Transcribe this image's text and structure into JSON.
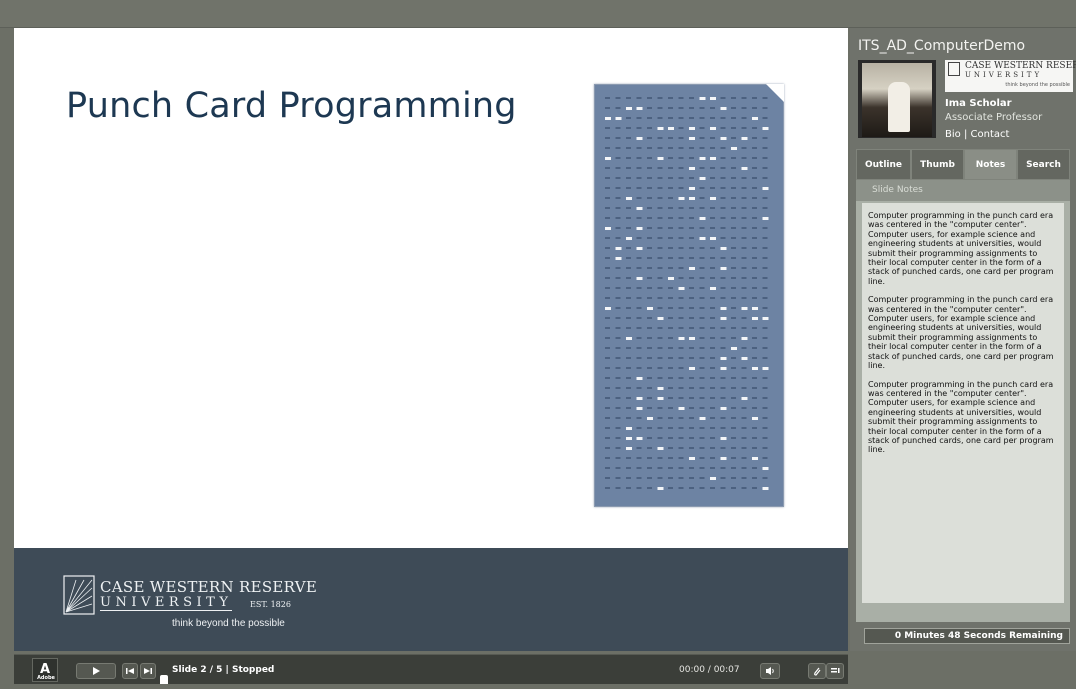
{
  "slide": {
    "title": "Punch Card Programming",
    "logo": {
      "name": "CASE WESTERN RESERVE",
      "university": "UNIVERSITY",
      "est": "EST. 1826",
      "tagline": "think beyond the possible"
    }
  },
  "sidebar": {
    "presentation_title": "ITS_AD_ComputerDemo",
    "small_logo": {
      "name": "CASE WESTERN RESERVE",
      "university": "UNIVERSITY",
      "tagline": "think beyond the possible"
    },
    "presenter": {
      "name": "Ima Scholar",
      "role": "Associate Professor",
      "bio_label": "Bio",
      "separator": "|",
      "contact_label": "Contact"
    },
    "tabs": [
      {
        "label": "Outline"
      },
      {
        "label": "Thumb"
      },
      {
        "label": "Notes"
      },
      {
        "label": "Search"
      }
    ],
    "active_tab": "Notes",
    "notes_header": "Slide Notes",
    "notes": [
      "Computer programming in the punch card era was centered in the \"computer center\". Computer users, for example science and engineering students at universities, would submit their programming assignments to their local computer center in the form of a stack of punched cards, one card per program line.",
      "Computer programming in the punch card era was centered in the \"computer center\". Computer users, for example science and engineering students at universities, would submit their programming assignments to their local computer center in the form of a stack of punched cards, one card per program line.",
      "Computer programming in the punch card era was centered in the \"computer center\". Computer users, for example science and engineering students at universities, would submit their programming assignments to their local computer center in the form of a stack of punched cards, one card per program line."
    ],
    "remaining": "0 Minutes 48 Seconds Remaining"
  },
  "playbar": {
    "adobe_label": "Adobe",
    "play_icon": "play-icon",
    "prev_icon": "skip-previous-icon",
    "next_icon": "skip-next-icon",
    "slide_status": "Slide 2 / 5 | Stopped",
    "time": "00:00 / 00:07",
    "volume_icon": "volume-icon",
    "attachment_icon": "paperclip-icon",
    "menu_icon": "menu-icon",
    "progress_fraction": 0.0
  },
  "colors": {
    "title": "#1d3852",
    "footer": "#3e4b57",
    "chrome": "#6c6f66",
    "punch_card": "#6d83a3"
  }
}
